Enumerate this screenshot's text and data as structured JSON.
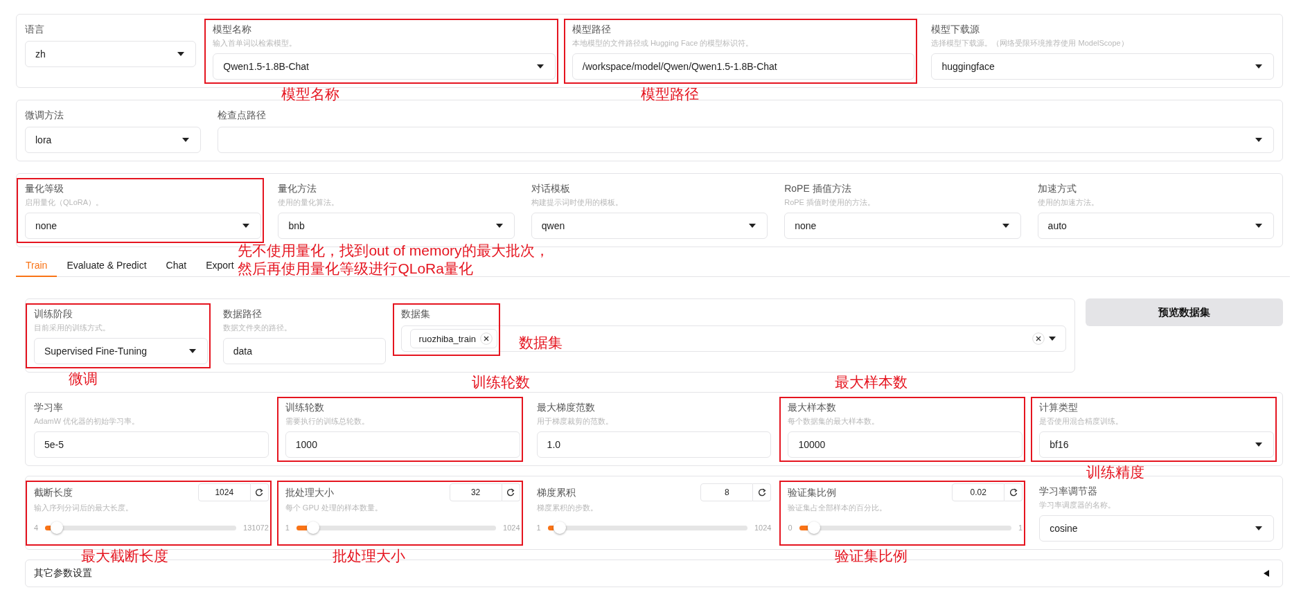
{
  "top_panels": [
    {
      "kind": "model",
      "fields": [
        {
          "kind": "dropdown",
          "label": "语言",
          "value": "zh"
        },
        {
          "kind": "dropdown",
          "label": "模型名称",
          "info": "输入首单词以检索模型。",
          "value": "Qwen1.5-1.8B-Chat",
          "note": "模型名称"
        },
        {
          "kind": "text",
          "label": "模型路径",
          "info": "本地模型的文件路径或 Hugging Face 的模型标识符。",
          "value": "/workspace/model/Qwen/Qwen1.5-1.8B-Chat",
          "note": "模型路径"
        },
        {
          "kind": "dropdown",
          "label": "模型下载源",
          "info": "选择模型下载源。（网络受限环境推荐使用 ModelScope）",
          "value": "huggingface"
        }
      ]
    },
    {
      "kind": "adapter",
      "fields": [
        {
          "kind": "dropdown",
          "label": "微调方法",
          "value": "lora"
        },
        {
          "kind": "dropdown",
          "label": "检查点路径"
        }
      ]
    },
    {
      "kind": "five",
      "fields": [
        {
          "kind": "dropdown",
          "label": "量化等级",
          "info": "启用量化（QLoRA）。",
          "value": "none",
          "note": "先不使用量化，找到out of memory的最大批次，然后再使用量化等级进行QLoRa量化"
        },
        {
          "kind": "dropdown",
          "label": "量化方法",
          "info": "使用的量化算法。",
          "value": "bnb"
        },
        {
          "kind": "dropdown",
          "label": "对话模板",
          "info": "构建提示词时使用的模板。",
          "value": "qwen"
        },
        {
          "kind": "dropdown",
          "label": "RoPE 插值方法",
          "info": "RoPE 插值时使用的方法。",
          "value": "none"
        },
        {
          "kind": "dropdown",
          "label": "加速方式",
          "info": "使用的加速方法。",
          "value": "auto"
        }
      ]
    }
  ],
  "tabs": [
    {
      "label": "Train",
      "selected": true
    },
    {
      "label": "Evaluate & Predict",
      "selected": false
    },
    {
      "label": "Chat",
      "selected": false
    },
    {
      "label": "Export",
      "selected": false
    }
  ],
  "dataset_panel": {
    "kind": "dataset",
    "fields": [
      {
        "kind": "dropdown",
        "label": "训练阶段",
        "info": "目前采用的训练方式。",
        "value": "Supervised Fine-Tuning",
        "note": "微调"
      },
      {
        "kind": "text",
        "label": "数据路径",
        "info": "数据文件夹的路径。",
        "value": "data"
      },
      {
        "kind": "multiselect",
        "label": "数据集",
        "tags": [
          "ruozhiba_train"
        ],
        "note": "数据集"
      }
    ]
  },
  "preview_button": "预览数据集",
  "param_panels": [
    {
      "kind": "five",
      "fields": [
        {
          "kind": "text",
          "label": "学习率",
          "info": "AdamW 优化器的初始学习率。",
          "value": "5e-5"
        },
        {
          "kind": "text",
          "label": "训练轮数",
          "info": "需要执行的训练总轮数。",
          "value": "1000",
          "note": "训练轮数"
        },
        {
          "kind": "text",
          "label": "最大梯度范数",
          "info": "用于梯度裁剪的范数。",
          "value": "1.0"
        },
        {
          "kind": "text",
          "label": "最大样本数",
          "info": "每个数据集的最大样本数。",
          "value": "10000",
          "note": "最大样本数"
        },
        {
          "kind": "dropdown",
          "label": "计算类型",
          "info": "是否使用混合精度训练。",
          "value": "bf16",
          "note": "训练精度"
        }
      ]
    },
    {
      "kind": "five",
      "fields": [
        {
          "kind": "slider",
          "label": "截断长度",
          "info": "输入序列分词后的最大长度。",
          "value": "1024",
          "min": "4",
          "max": "131072",
          "level": 0.008,
          "note": "最大截断长度"
        },
        {
          "kind": "slider",
          "label": "批处理大小",
          "info": "每个 GPU 处理的样本数量。",
          "value": "32",
          "min": "1",
          "max": "1024",
          "level": 0.03,
          "note": "批处理大小"
        },
        {
          "kind": "slider",
          "label": "梯度累积",
          "info": "梯度累积的步数。",
          "value": "8",
          "min": "1",
          "max": "1024",
          "level": 0.007
        },
        {
          "kind": "slider",
          "label": "验证集比例",
          "info": "验证集占全部样本的百分比。",
          "value": "0.02",
          "min": "0",
          "max": "1",
          "level": 0.02,
          "note": "验证集比例"
        },
        {
          "kind": "dropdown",
          "label": "学习率调节器",
          "info": "学习率调度器的名称。",
          "value": "cosine"
        }
      ]
    }
  ],
  "accordion": {
    "label": "其它参数设置",
    "expanded": false
  }
}
